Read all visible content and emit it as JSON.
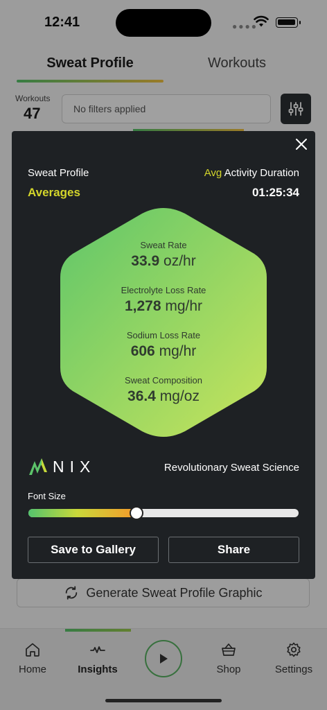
{
  "status_bar": {
    "time": "12:41"
  },
  "tabs": {
    "active": "Sweat Profile",
    "inactive": "Workouts"
  },
  "workouts": {
    "label": "Workouts",
    "count": "47"
  },
  "filter": {
    "placeholder": "No filters applied"
  },
  "generate_button": {
    "label": "Generate Sweat Profile Graphic"
  },
  "modal": {
    "title": "Sweat Profile",
    "subtitle": "Averages",
    "duration_accent": "Avg",
    "duration_label": "Activity Duration",
    "duration_value": "01:25:34",
    "metrics": [
      {
        "label": "Sweat Rate",
        "value": "33.9",
        "unit": "oz/hr"
      },
      {
        "label": "Electrolyte Loss Rate",
        "value": "1,278",
        "unit": "mg/hr"
      },
      {
        "label": "Sodium Loss Rate",
        "value": "606",
        "unit": "mg/hr"
      },
      {
        "label": "Sweat Composition",
        "value": "36.4",
        "unit": "mg/oz"
      }
    ],
    "brand": "NIX",
    "tagline": "Revolutionary Sweat Science",
    "font_size_label": "Font Size",
    "font_size_fraction": 0.4,
    "save_label": "Save to Gallery",
    "share_label": "Share"
  },
  "nav": {
    "items": [
      {
        "label": "Home",
        "icon": "home-icon"
      },
      {
        "label": "Insights",
        "icon": "insights-icon"
      },
      {
        "label": "Shop",
        "icon": "basket-icon"
      },
      {
        "label": "Settings",
        "icon": "gear-icon"
      }
    ],
    "play_icon": "play-icon"
  },
  "colors": {
    "accent_yellow": "#d4d62b",
    "modal_bg": "#1e2124",
    "hex_gradient_start": "#66c96a",
    "hex_gradient_end": "#c5e35b"
  }
}
